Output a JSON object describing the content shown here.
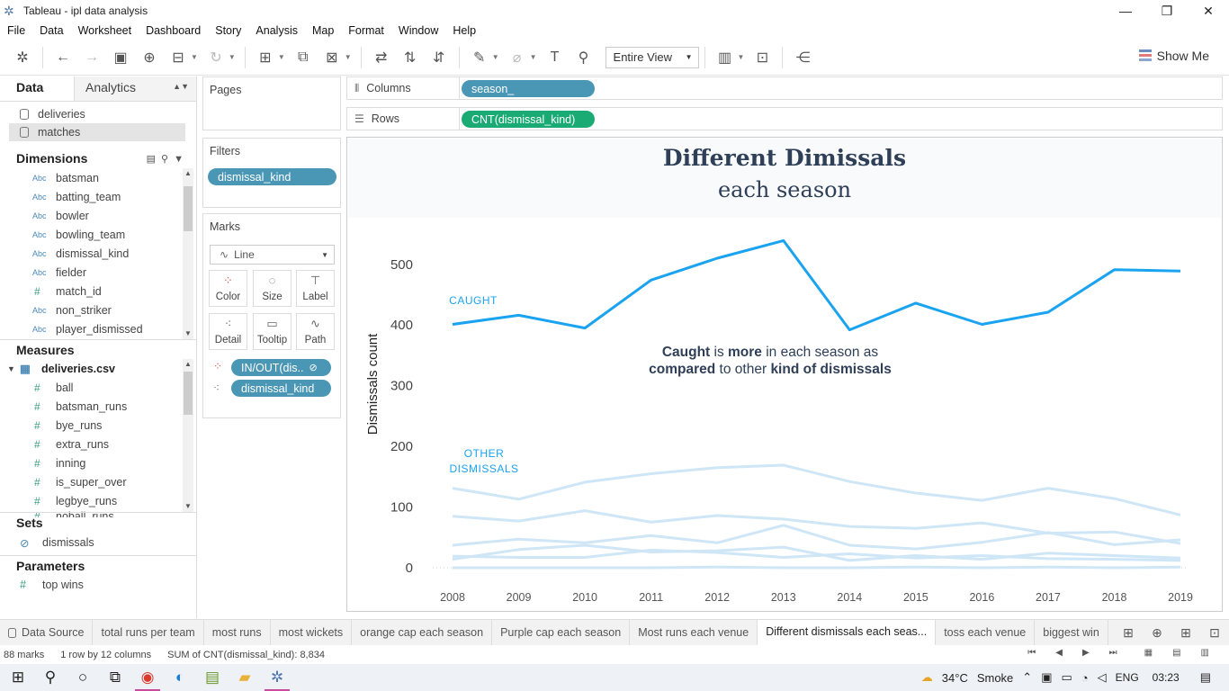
{
  "window": {
    "title": "Tableau - ipl data analysis",
    "minimize": "—",
    "restore": "❐",
    "close": "✕"
  },
  "menu": [
    "File",
    "Data",
    "Worksheet",
    "Dashboard",
    "Story",
    "Analysis",
    "Map",
    "Format",
    "Window",
    "Help"
  ],
  "toolbar": {
    "view_mode": "Entire View",
    "show_me": "Show Me"
  },
  "left_panel": {
    "tab_data": "Data",
    "tab_analytics": "Analytics",
    "datasources": [
      "deliveries",
      "matches"
    ],
    "dimensions_title": "Dimensions",
    "dimensions": [
      {
        "type": "Abc",
        "name": "batsman"
      },
      {
        "type": "Abc",
        "name": "batting_team"
      },
      {
        "type": "Abc",
        "name": "bowler"
      },
      {
        "type": "Abc",
        "name": "bowling_team"
      },
      {
        "type": "Abc",
        "name": "dismissal_kind"
      },
      {
        "type": "Abc",
        "name": "fielder"
      },
      {
        "type": "#",
        "name": "match_id"
      },
      {
        "type": "Abc",
        "name": "non_striker"
      },
      {
        "type": "Abc",
        "name": "player_dismissed"
      }
    ],
    "measures_title": "Measures",
    "measures_table": "deliveries.csv",
    "measures": [
      "ball",
      "batsman_runs",
      "bye_runs",
      "extra_runs",
      "inning",
      "is_super_over",
      "legbye_runs",
      "noball_runs"
    ],
    "sets_title": "Sets",
    "sets": [
      "dismissals"
    ],
    "parameters_title": "Parameters",
    "parameters": [
      "top wins"
    ]
  },
  "shelves": {
    "pages": "Pages",
    "filters": "Filters",
    "filter_pills": [
      "dismissal_kind"
    ],
    "marks": "Marks",
    "mark_type": "Line",
    "mark_buttons": [
      "Color",
      "Size",
      "Label",
      "Detail",
      "Tooltip",
      "Path"
    ],
    "mark_pills": [
      "IN/OUT(dis..",
      "dismissal_kind"
    ],
    "columns_label": "Columns",
    "columns_pill": "season_",
    "rows_label": "Rows",
    "rows_pill": "CNT(dismissal_kind)"
  },
  "viz": {
    "title": "Different Dimissals",
    "subtitle": "each season",
    "annotation_caught": "CAUGHT",
    "annotation_other_1": "OTHER",
    "annotation_other_2": "DISMISSALS",
    "callout_parts": [
      {
        "text": "Caught",
        "bold": true
      },
      {
        "text": " is ",
        "bold": false
      },
      {
        "text": "more",
        "bold": true
      },
      {
        "text": " in each season as",
        "bold": false
      }
    ],
    "callout_parts_2": [
      {
        "text": "compared",
        "bold": true
      },
      {
        "text": " to other ",
        "bold": false
      },
      {
        "text": "kind of dismissals",
        "bold": true
      }
    ],
    "colors": {
      "caught": "#1aa3f0",
      "other": "#cfe6f7",
      "title": "#2e3f57"
    }
  },
  "chart_data": {
    "type": "line",
    "title": "Different Dimissals",
    "subtitle": "each season",
    "xlabel": "",
    "ylabel": "Dismissals count",
    "x": [
      2008,
      2009,
      2010,
      2011,
      2012,
      2013,
      2014,
      2015,
      2016,
      2017,
      2018,
      2019
    ],
    "ylim": [
      0,
      550
    ],
    "yticks": [
      0,
      100,
      200,
      300,
      400,
      500
    ],
    "grid": false,
    "series": [
      {
        "name": "CAUGHT",
        "values": [
          401,
          416,
          395,
          474,
          510,
          539,
          392,
          436,
          401,
          421,
          491,
          489
        ],
        "highlight": true
      },
      {
        "values": [
          131,
          113,
          141,
          155,
          165,
          169,
          142,
          123,
          111,
          131,
          114,
          87
        ]
      },
      {
        "values": [
          85,
          77,
          94,
          75,
          86,
          80,
          68,
          65,
          74,
          57,
          59,
          40
        ]
      },
      {
        "values": [
          37,
          47,
          41,
          53,
          41,
          70,
          37,
          31,
          42,
          58,
          38,
          46
        ]
      },
      {
        "values": [
          14,
          30,
          37,
          26,
          28,
          34,
          12,
          20,
          14,
          24,
          20,
          16
        ]
      },
      {
        "values": [
          19,
          17,
          17,
          29,
          25,
          17,
          23,
          16,
          20,
          15,
          14,
          12
        ]
      },
      {
        "values": [
          0,
          0,
          0,
          0,
          1,
          0,
          0,
          1,
          0,
          1,
          0,
          1
        ]
      }
    ]
  },
  "sheet_tabs": [
    "Data Source",
    "total runs per team",
    "most runs",
    "most wickets",
    "orange cap each season",
    "Purple cap each season",
    "Most runs each venue",
    "Different dismissals each seas...",
    "toss each venue",
    "biggest win"
  ],
  "active_tab": "Different dismissals each seas...",
  "status": {
    "marks": "88 marks",
    "dims": "1 row by 12 columns",
    "sum": "SUM of CNT(dismissal_kind): 8,834"
  },
  "taskbar": {
    "weather_temp": "34°C",
    "weather_text": "Smoke",
    "lang": "ENG",
    "time": "03:23"
  }
}
